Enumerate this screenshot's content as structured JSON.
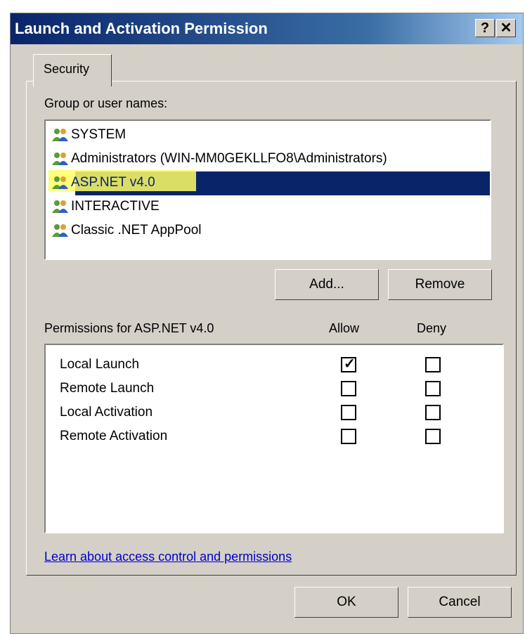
{
  "window": {
    "title": "Launch and Activation Permission",
    "help_label": "?",
    "close_label": "✕"
  },
  "tabs": [
    {
      "label": "Security"
    }
  ],
  "groups": {
    "label": "Group or user names:",
    "items": [
      {
        "name": "SYSTEM"
      },
      {
        "name": "Administrators (WIN-MM0GEKLLFO8\\Administrators)"
      },
      {
        "name": "ASP.NET v4.0"
      },
      {
        "name": "INTERACTIVE"
      },
      {
        "name": "Classic .NET AppPool"
      }
    ]
  },
  "buttons": {
    "add": "Add...",
    "remove": "Remove",
    "ok": "OK",
    "cancel": "Cancel"
  },
  "permissions": {
    "label": "Permissions for ASP.NET v4.0",
    "allow_header": "Allow",
    "deny_header": "Deny",
    "rows": [
      {
        "name": "Local Launch",
        "allow": true,
        "deny": false
      },
      {
        "name": "Remote Launch",
        "allow": false,
        "deny": false
      },
      {
        "name": "Local Activation",
        "allow": false,
        "deny": false
      },
      {
        "name": "Remote Activation",
        "allow": false,
        "deny": false
      }
    ]
  },
  "link": {
    "text": "Learn about access control and permissions"
  },
  "colors": {
    "title_bar": "#0a246a",
    "selection": "#0a246a",
    "highlighter": "#ffff66",
    "face": "#d4d0c8"
  }
}
